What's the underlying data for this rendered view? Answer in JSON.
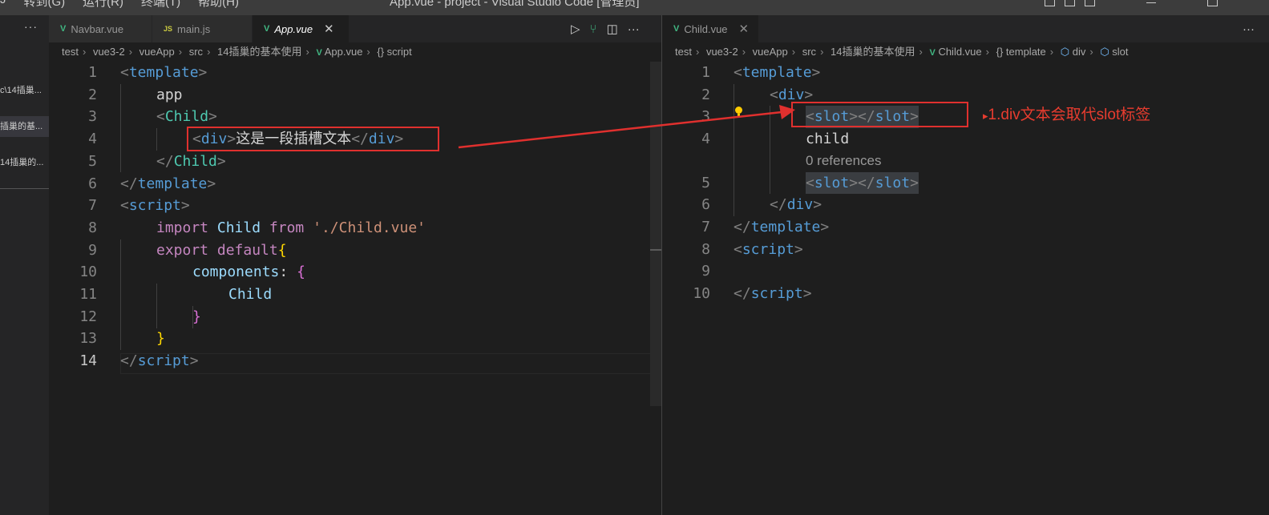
{
  "titlebar": {
    "menus": [
      "J",
      "转到(G)",
      "运行(R)",
      "终端(T)",
      "帮助(H)"
    ],
    "window_title": "App.vue - project - Visual Studio Code [管理员]"
  },
  "left_panel": {
    "more": "···",
    "items": [
      "c\\14插巢...",
      "插巢的基...",
      "14插巢的..."
    ]
  },
  "left_editor": {
    "tabs": [
      {
        "icon": "V",
        "label": "Navbar.vue"
      },
      {
        "icon": "JS",
        "label": "main.js"
      },
      {
        "icon": "V",
        "label": "App.vue",
        "close": "✕"
      }
    ],
    "actions": [
      "▷",
      "⑂",
      "◫",
      "···"
    ],
    "breadcrumb": {
      "parts": [
        "test",
        "vue3-2",
        "vueApp",
        "src",
        "14插巢的基本使用"
      ],
      "file": "App.vue",
      "symbol": "{} script"
    },
    "line_numbers": [
      "1",
      "2",
      "3",
      "4",
      "5",
      "6",
      "7",
      "8",
      "9",
      "10",
      "11",
      "12",
      "13",
      "14"
    ],
    "lines": {
      "l1_tag": "template",
      "l2_text": "app",
      "l3_tag": "Child",
      "l4_tag_open": "div",
      "l4_text": "这是一段插槽文本",
      "l4_tag_close": "div",
      "l5_tag": "Child",
      "l6_tag": "template",
      "l7_tag": "script",
      "l8_import": "import",
      "l8_name": "Child",
      "l8_from": "from",
      "l8_path": "'./Child.vue'",
      "l9_export": "export",
      "l9_default": "default",
      "l9_brace": "{",
      "l10_prop": "components",
      "l10_colon": ":",
      "l10_brace": "{",
      "l11_name": "Child",
      "l12_brace": "}",
      "l13_brace": "}",
      "l14_tag": "script"
    }
  },
  "right_editor": {
    "tab": {
      "icon": "V",
      "label": "Child.vue",
      "close": "✕"
    },
    "actions": [
      "···"
    ],
    "breadcrumb": {
      "parts": [
        "test",
        "vue3-2",
        "vueApp",
        "src",
        "14插巢的基本使用"
      ],
      "file": "Child.vue",
      "symbols": [
        "{} template",
        "div",
        "slot"
      ]
    },
    "line_numbers": [
      "1",
      "2",
      "3",
      "4",
      "5",
      "6",
      "7",
      "8",
      "9",
      "10"
    ],
    "codelens": "0 references",
    "lines": {
      "l1_tag": "template",
      "l2_tag": "div",
      "l3_slot_open": "slot",
      "l3_slot_close": "slot",
      "l4_text": "child",
      "l5_slot_open": "slot",
      "l5_slot_close": "slot",
      "l6_tag": "div",
      "l7_tag": "template",
      "l8_tag": "script",
      "l10_tag": "script"
    }
  },
  "annotation": {
    "marker": "▸",
    "note": "1.div文本会取代slot标签"
  },
  "colors": {
    "annotation_red": "#e0302e",
    "tag_blue": "#569cd6",
    "component_teal": "#4ec9b0",
    "keyword_purple": "#c586c0",
    "string_orange": "#ce9178",
    "vue_green": "#41b883"
  }
}
